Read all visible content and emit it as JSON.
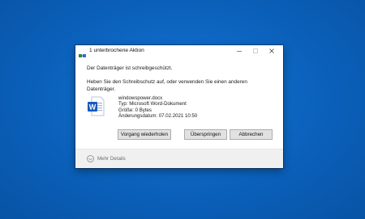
{
  "window": {
    "title": "1 unterbrochene Aktion"
  },
  "message": {
    "headline": "Der Datenträger ist schreibgeschützt.",
    "instruction": "Heben Sie den Schreibschutz auf, oder verwenden Sie einen anderen Datenträger."
  },
  "file": {
    "icon": "word-document-icon",
    "name": "windowspower.docx",
    "type": "Typ: Microsoft Word-Dokument",
    "size": "Größe: 0 Bytes",
    "modified": "Änderungsdatum: 07.02.2021 10:50"
  },
  "buttons": {
    "retry": "Vorgang wiederholen",
    "skip": "Überspringen",
    "cancel": "Abbrechen"
  },
  "footer": {
    "details": "Mehr Details"
  },
  "colors": {
    "desktop": "#0b63bf",
    "word_blue": "#185abd"
  }
}
